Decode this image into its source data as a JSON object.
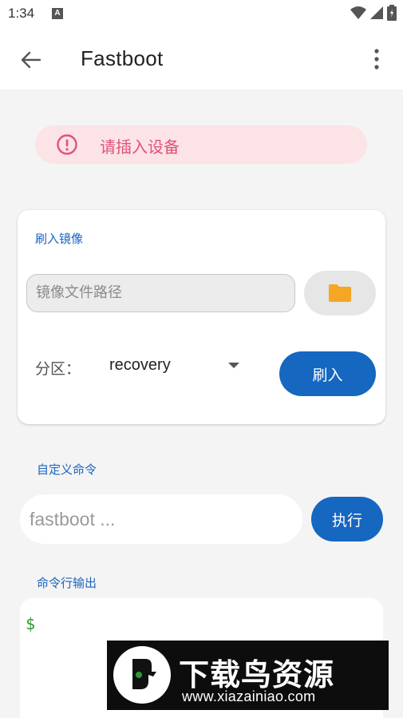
{
  "status_bar": {
    "time": "1:34",
    "notification_letter": "A"
  },
  "app_bar": {
    "title": "Fastboot"
  },
  "alert": {
    "text": "请插入设备"
  },
  "flash_section": {
    "label": "刷入镜像",
    "path_placeholder": "镜像文件路径",
    "partition_label": "分区：",
    "partition_value": "recovery",
    "flash_button": "刷入"
  },
  "custom_command": {
    "label": "自定义命令",
    "placeholder": "fastboot ...",
    "execute_button": "执行"
  },
  "output": {
    "label": "命令行输出",
    "prompt": "$"
  },
  "watermark": {
    "title": "下载鸟资源",
    "url": "www.xiazainiao.com"
  },
  "colors": {
    "accent": "#1567c0",
    "alert_bg": "#fbe3e6",
    "alert_text": "#e2527a",
    "folder": "#f5a623",
    "prompt": "#2d9a34"
  }
}
